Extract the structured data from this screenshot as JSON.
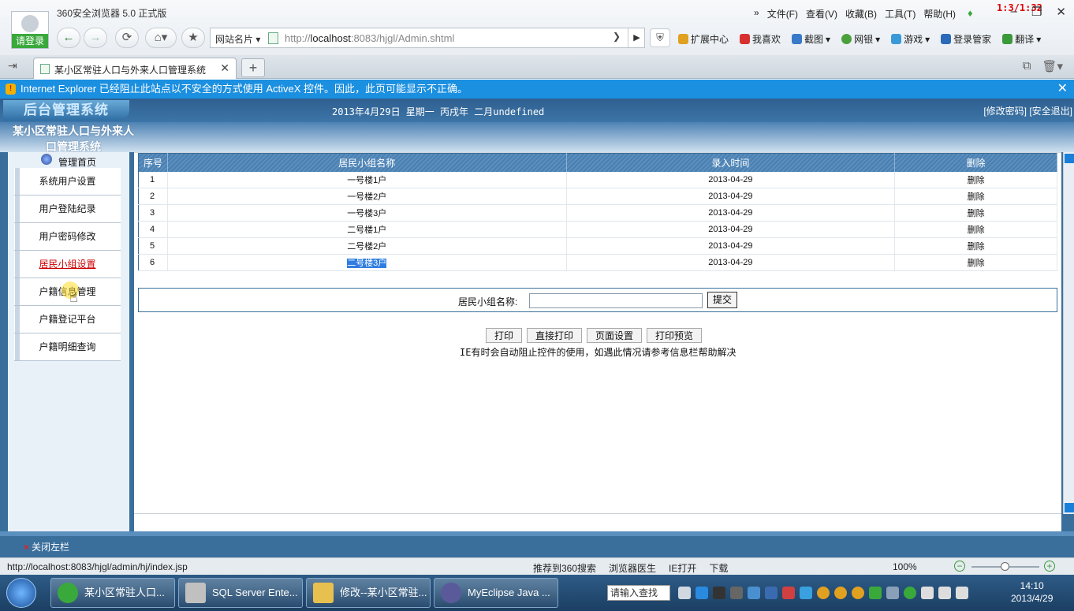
{
  "browser": {
    "login_label": "请登录",
    "app_title": "360安全浏览器 5.0 正式版",
    "menus": [
      "文件(F)",
      "查看(V)",
      "收藏(B)",
      "工具(T)",
      "帮助(H)"
    ],
    "menu_more": "»",
    "recording_timer": "1:3/1:32",
    "sites_label": "网站名片",
    "url_prefix": "http://",
    "url_host": "localhost",
    "url_rest": ":8083/hjgl/Admin.shtml",
    "plugins": [
      "扩展中心",
      "我喜欢",
      "截图",
      "网银",
      "游戏",
      "登录管家",
      "翻译"
    ],
    "tab_title": "某小区常驻人口与外来人口管理系统",
    "infobar_text": "Internet Explorer 已经阻止此站点以不安全的方式使用 ActiveX 控件。因此，此页可能显示不正确。"
  },
  "page": {
    "brand": "后台管理系统",
    "date_text": "2013年4月29日 星期一 丙戌年 二月undefined",
    "top_links": "[修改密码] [安全退出]",
    "system_title": "某小区常驻人口与外来人口管理系统",
    "home_label": "管理首页",
    "nav_items": [
      {
        "label": "系统用户设置"
      },
      {
        "label": "用户登陆纪录"
      },
      {
        "label": "用户密码修改"
      },
      {
        "label": "居民小组设置"
      },
      {
        "label": "户籍信息管理"
      },
      {
        "label": "户籍登记平台"
      },
      {
        "label": "户籍明细查询"
      }
    ],
    "table": {
      "headers": [
        "序号",
        "居民小组名称",
        "录入时间",
        "删除"
      ],
      "rows": [
        {
          "no": "1",
          "name": "一号楼1户",
          "date": "2013-04-29",
          "action": "删除"
        },
        {
          "no": "2",
          "name": "一号楼2户",
          "date": "2013-04-29",
          "action": "删除"
        },
        {
          "no": "3",
          "name": "一号楼3户",
          "date": "2013-04-29",
          "action": "删除"
        },
        {
          "no": "4",
          "name": "二号楼1户",
          "date": "2013-04-29",
          "action": "删除"
        },
        {
          "no": "5",
          "name": "二号楼2户",
          "date": "2013-04-29",
          "action": "删除"
        },
        {
          "no": "6",
          "name": "二号楼3户",
          "date": "2013-04-29",
          "action": "删除"
        }
      ]
    },
    "form": {
      "label": "居民小组名称:",
      "value": "",
      "submit_label": "提交"
    },
    "print_buttons": [
      "打印",
      "直接打印",
      "页面设置",
      "打印预览"
    ],
    "print_note": "IE有时会自动阻止控件的使用，如遇此情况请参考信息栏帮助解决",
    "close_left": "关闭左栏"
  },
  "status": {
    "url": "http://localhost:8083/hjgl/admin/hj/index.jsp",
    "items": [
      "推荐到360搜索",
      "浏览器医生",
      "IE打开",
      "下载"
    ],
    "zoom": "100%"
  },
  "taskbar": {
    "buttons": [
      "某小区常驻人口...",
      "SQL Server Ente...",
      "修改--某小区常驻...",
      "MyEclipse Java ..."
    ],
    "search_placeholder": "请输入查找",
    "time": "14:10",
    "date": "2013/4/29"
  }
}
